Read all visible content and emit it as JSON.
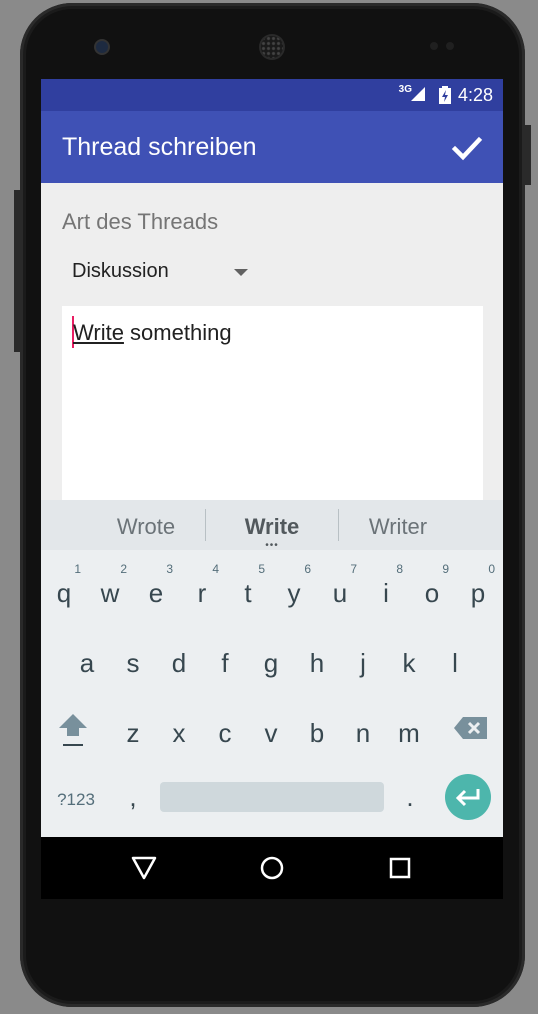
{
  "status_bar": {
    "network": "3G",
    "time": "4:28"
  },
  "app_bar": {
    "title": "Thread schreiben",
    "confirm_icon": "check-icon"
  },
  "form": {
    "type_label": "Art des Threads",
    "type_value": "Diskussion",
    "text_underlined": "Write",
    "text_rest": " something"
  },
  "keyboard": {
    "suggestions": [
      "Wrote",
      "Write",
      "Writer"
    ],
    "row1": [
      {
        "key": "q",
        "hint": "1"
      },
      {
        "key": "w",
        "hint": "2"
      },
      {
        "key": "e",
        "hint": "3"
      },
      {
        "key": "r",
        "hint": "4"
      },
      {
        "key": "t",
        "hint": "5"
      },
      {
        "key": "y",
        "hint": "6"
      },
      {
        "key": "u",
        "hint": "7"
      },
      {
        "key": "i",
        "hint": "8"
      },
      {
        "key": "o",
        "hint": "9"
      },
      {
        "key": "p",
        "hint": "0"
      }
    ],
    "row2": [
      "a",
      "s",
      "d",
      "f",
      "g",
      "h",
      "j",
      "k",
      "l"
    ],
    "row3": [
      "z",
      "x",
      "c",
      "v",
      "b",
      "n",
      "m"
    ],
    "symbols_label": "?123",
    "comma": ",",
    "period": ".",
    "shift_icon": "shift-icon",
    "backspace_icon": "backspace-icon",
    "enter_icon": "enter-icon"
  },
  "nav_bar": {
    "back_icon": "back-icon",
    "home_icon": "home-icon",
    "recents_icon": "recents-icon"
  },
  "colors": {
    "primary": "#3f51b5",
    "primary_dark": "#303f9f",
    "accent": "#e91e63",
    "enter": "#4db6ac"
  }
}
